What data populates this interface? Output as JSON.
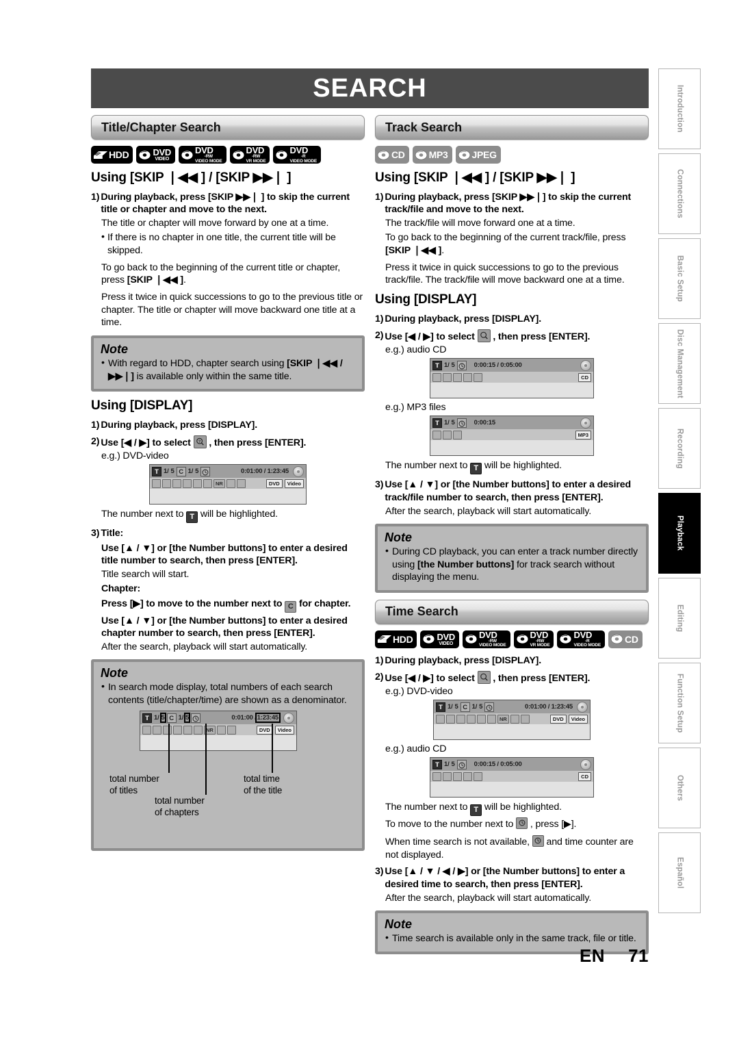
{
  "page": {
    "header_title": "SEARCH",
    "footer_lang": "EN",
    "footer_page": "71"
  },
  "sidebar": {
    "tabs": [
      {
        "label": "Introduction",
        "active": false
      },
      {
        "label": "Connections",
        "active": false
      },
      {
        "label": "Basic Setup",
        "active": false
      },
      {
        "label": "Disc Management",
        "active": false
      },
      {
        "label": "Recording",
        "active": false
      },
      {
        "label": "Playback",
        "active": true
      },
      {
        "label": "Editing",
        "active": false
      },
      {
        "label": "Function Setup",
        "active": false
      },
      {
        "label": "Others",
        "active": false
      },
      {
        "label": "Español",
        "active": false
      }
    ]
  },
  "title_chapter_search": {
    "heading": "Title/Chapter Search",
    "badges": [
      "HDD",
      "DVD VIDEO",
      "DVD -RW VIDEO MODE",
      "DVD -RW VR MODE",
      "DVD -R VIDEO MODE"
    ],
    "using_skip_heading": "Using [SKIP ❘◀◀ ] / [SKIP ▶▶❘ ]",
    "step1_num": "1)",
    "step1_text": "During playback, press [SKIP ▶▶❘ ] to skip the current title or chapter and move to the next.",
    "p1": "The title or chapter will move forward by one at a time.",
    "bullet1": "If there is no chapter in one title, the current title will be skipped.",
    "p2_a": "To go back to the beginning of the current title or chapter, press ",
    "p2_b": "[SKIP ❘◀◀ ]",
    "p2_c": ".",
    "p3": "Press it twice in quick successions to go to the previous title or chapter. The title or chapter will move backward one title at a time.",
    "note1_title": "Note",
    "note1_a": "With regard to HDD, chapter search using ",
    "note1_b": "[SKIP ❘◀◀ / ▶▶❘]",
    "note1_c": " is available only within the same title.",
    "using_display_heading": "Using [DISPLAY]",
    "d_step1_num": "1)",
    "d_step1_text": "During playback, press [DISPLAY].",
    "d_step2_num": "2)",
    "d_step2_a": "Use [◀ / ▶] to select ",
    "d_step2_b": " , then press [ENTER].",
    "eg_dvd": "e.g.) DVD-video",
    "osd_dvd": {
      "title_icon": "T",
      "title_num": "1/",
      "title_total": "5",
      "chapter_icon": "C",
      "chapter_num": "1/",
      "chapter_total": "5",
      "time": "0:01:00 / 1:23:45",
      "tags": [
        "DVD",
        "Video"
      ]
    },
    "highlight_note_a": "The number next to ",
    "highlight_note_b": " will be highlighted.",
    "step3_num": "3)",
    "step3_title_label": "Title:",
    "step3_title_text": "Use [▲ / ▼] or [the Number buttons] to enter a desired title number to search, then press [ENTER].",
    "step3_title_after": "Title search will start.",
    "step3_chapter_label": "Chapter:",
    "step3_chapter_a": "Press [▶] to move to the number next to ",
    "step3_chapter_b": " for chapter.",
    "step3_chapter_text": "Use [▲ / ▼] or [the Number buttons] to enter a desired chapter number to search, then press [ENTER].",
    "step3_after": "After the search, playback will start automatically.",
    "note2_title": "Note",
    "note2_text": "In search mode display, total numbers of each search contents (title/chapter/time) are shown as a denominator.",
    "anno_titles": "total number\nof titles",
    "anno_chapters": "total number\nof chapters",
    "anno_time": "total time\nof the title"
  },
  "track_search": {
    "heading": "Track Search",
    "badges": [
      "CD",
      "MP3",
      "JPEG"
    ],
    "using_skip_heading": "Using [SKIP ❘◀◀ ] / [SKIP ▶▶❘ ]",
    "step1_num": "1)",
    "step1_text": "During playback, press [SKIP ▶▶❘] to skip the current track/file and move to the next.",
    "p1": "The track/file will move forward one at a time.",
    "p2_a": "To go back to the beginning of the current track/file, press ",
    "p2_b": "[SKIP ❘◀◀ ]",
    "p2_c": ".",
    "p3": "Press it twice in quick successions to go to the previous track/file. The track/file will move backward one at a time.",
    "using_display_heading": "Using [DISPLAY]",
    "d_step1_num": "1)",
    "d_step1_text": "During playback, press [DISPLAY].",
    "d_step2_num": "2)",
    "d_step2_a": "Use [◀ / ▶] to select ",
    "d_step2_b": " , then press [ENTER].",
    "eg_cd": "e.g.) audio CD",
    "osd_cd": {
      "title_icon": "T",
      "title_num": "1/",
      "title_total": "5",
      "time": "0:00:15 / 0:05:00",
      "tags": [
        "CD"
      ]
    },
    "eg_mp3": "e.g.) MP3 files",
    "osd_mp3": {
      "title_icon": "T",
      "title_num": "1/",
      "title_total": "5",
      "time": "0:00:15",
      "tags": [
        "MP3"
      ]
    },
    "highlight_note_a": "The number next to ",
    "highlight_note_b": " will be highlighted.",
    "step3_num": "3)",
    "step3_text": "Use [▲ / ▼] or [the Number buttons] to enter a desired track/file number to search, then press [ENTER].",
    "step3_after": "After the search, playback will start automatically.",
    "note_title": "Note",
    "note_a": "During CD playback, you can enter a track number directly using ",
    "note_b": "[the Number buttons]",
    "note_c": " for track search without displaying the menu."
  },
  "time_search": {
    "heading": "Time Search",
    "badges": [
      "HDD",
      "DVD VIDEO",
      "DVD -RW VIDEO MODE",
      "DVD -RW VR MODE",
      "DVD -R VIDEO MODE",
      "CD"
    ],
    "step1_num": "1)",
    "step1_text": "During playback, press [DISPLAY].",
    "step2_num": "2)",
    "step2_a": "Use [◀ / ▶] to select ",
    "step2_b": " , then press [ENTER].",
    "eg_dvd": "e.g.) DVD-video",
    "osd_dvd": {
      "title_icon": "T",
      "title_num": "1/",
      "title_total": "5",
      "chapter_icon": "C",
      "chapter_num": "1/",
      "chapter_total": "5",
      "time": "0:01:00 / 1:23:45",
      "tags": [
        "DVD",
        "Video"
      ]
    },
    "eg_cd": "e.g.) audio CD",
    "osd_cd": {
      "title_icon": "T",
      "title_num": "1/",
      "title_total": "5",
      "time": "0:00:15 / 0:05:00",
      "tags": [
        "CD"
      ]
    },
    "highlight_a": "The number next to ",
    "highlight_b": " will be highlighted.",
    "move_a": "To move to the number next to ",
    "move_b": " , press [▶].",
    "unavail_a": "When time search is not available, ",
    "unavail_b": " and time counter are not displayed.",
    "step3_num": "3)",
    "step3_text": "Use [▲ / ▼ / ◀ / ▶] or [the Number buttons] to enter a desired time to search, then press [ENTER].",
    "step3_after": "After the search, playback will start automatically.",
    "note_title": "Note",
    "note_text": "Time search is available only in the same track, file or title."
  },
  "colors": {
    "header_bar": "#4b4b4b",
    "note_bg": "#b9b9b9",
    "note_border": "#8d8d8d",
    "badge_black": "#000000",
    "badge_gray": "#8c8c8c",
    "tab_inactive_text": "#9a9a9a",
    "tab_active_bg": "#000000"
  }
}
